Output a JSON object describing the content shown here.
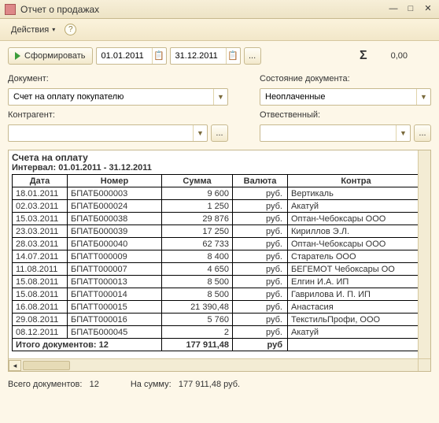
{
  "window": {
    "title": "Отчет о продажах"
  },
  "toolbar": {
    "actions_label": "Действия"
  },
  "controls": {
    "form_label": "Сформировать",
    "date_from": "01.01.2011",
    "date_to": "31.12.2011",
    "ellipsis": "...",
    "sigma": "Σ",
    "sum_value": "0,00"
  },
  "filters": {
    "doc_label": "Документ:",
    "doc_value": "Счет на оплату покупателю",
    "state_label": "Состояние документа:",
    "state_value": "Неоплаченные",
    "contr_label": "Контрагент:",
    "contr_value": "",
    "resp_label": "Отвественный:",
    "resp_value": ""
  },
  "report": {
    "title": "Счета на оплату",
    "interval": "Интервал: 01.01.2011 - 31.12.2011",
    "headers": {
      "date": "Дата",
      "number": "Номер",
      "sum": "Сумма",
      "currency": "Валюта",
      "contr": "Контра"
    },
    "rows": [
      {
        "date": "18.01.2011",
        "num": "БПАТБ000003",
        "sum": "9 600",
        "cur": "руб.",
        "contr": "Вертикаль"
      },
      {
        "date": "02.03.2011",
        "num": "БПАТБ000024",
        "sum": "1 250",
        "cur": "руб.",
        "contr": "Акатуй"
      },
      {
        "date": "15.03.2011",
        "num": "БПАТБ000038",
        "sum": "29 876",
        "cur": "руб.",
        "contr": "Оптан-Чебоксары ООО"
      },
      {
        "date": "23.03.2011",
        "num": "БПАТБ000039",
        "sum": "17 250",
        "cur": "руб.",
        "contr": "Кириллов Э.Л."
      },
      {
        "date": "28.03.2011",
        "num": "БПАТБ000040",
        "sum": "62 733",
        "cur": "руб.",
        "contr": "Оптан-Чебоксары ООО"
      },
      {
        "date": "14.07.2011",
        "num": "БПАТТ000009",
        "sum": "8 400",
        "cur": "руб.",
        "contr": "Старатель ООО"
      },
      {
        "date": "11.08.2011",
        "num": "БПАТТ000007",
        "sum": "4 650",
        "cur": "руб.",
        "contr": "БЕГЕМОТ Чебоксары ОО"
      },
      {
        "date": "15.08.2011",
        "num": "БПАТТ000013",
        "sum": "8 500",
        "cur": "руб.",
        "contr": "Елгин И.А. ИП"
      },
      {
        "date": "15.08.2011",
        "num": "БПАТТ000014",
        "sum": "8 500",
        "cur": "руб.",
        "contr": "Гаврилова И. П. ИП"
      },
      {
        "date": "16.08.2011",
        "num": "БПАТТ000015",
        "sum": "21 390,48",
        "cur": "руб.",
        "contr": "Анастасия"
      },
      {
        "date": "29.08.2011",
        "num": "БПАТТ000016",
        "sum": "5 760",
        "cur": "руб.",
        "contr": "ТекстильПрофи, ООО"
      },
      {
        "date": "08.12.2011",
        "num": "БПАТБ000045",
        "sum": "2",
        "cur": "руб.",
        "contr": "Акатуй"
      }
    ],
    "total_label": "Итого документов: 12",
    "total_sum": "177 911,48",
    "total_cur": "руб"
  },
  "status": {
    "docs_label": "Всего документов:",
    "docs_value": "12",
    "sum_label": "На сумму:",
    "sum_value": "177 911,48 руб."
  }
}
